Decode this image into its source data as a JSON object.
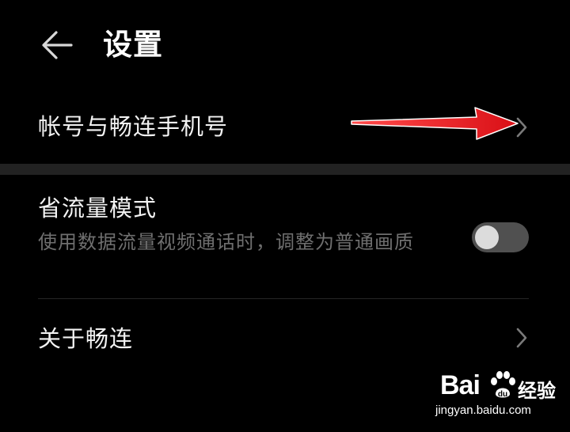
{
  "header": {
    "title": "设置",
    "back_icon": "arrow-left-icon"
  },
  "settings": {
    "account": {
      "label": "帐号与畅连手机号",
      "icon": "chevron-right-icon"
    },
    "data_saver": {
      "label": "省流量模式",
      "description": "使用数据流量视频通话时，调整为普通画质",
      "enabled": false
    },
    "about": {
      "label": "关于畅连",
      "icon": "chevron-right-icon"
    }
  },
  "annotation": {
    "arrow_color": "#e8141c"
  },
  "watermark": {
    "logo": "Bai",
    "logo_cn": "经验",
    "url": "jingyan.baidu.com"
  },
  "colors": {
    "background": "#000000",
    "text_primary": "#f2f2f2",
    "text_secondary": "#6f6f6f",
    "section_gap": "#222222",
    "toggle_track": "#505050"
  }
}
